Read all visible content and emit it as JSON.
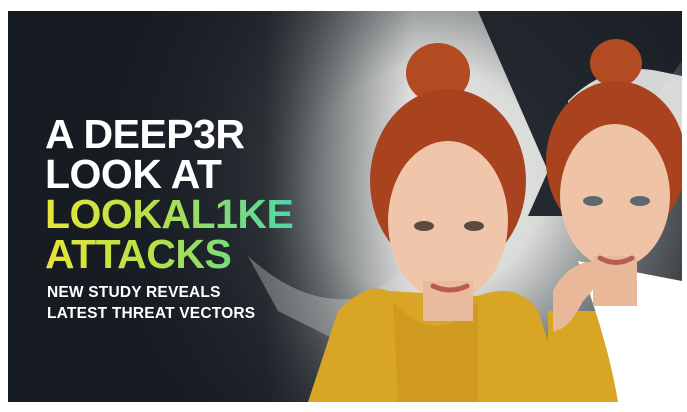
{
  "headline": {
    "line1": "A DEEP3R",
    "line2": "LOOK AT",
    "line3": "LOOKAL1KE",
    "line4": "ATTACKS"
  },
  "subheadline": {
    "line1": "NEW STUDY REVEALS",
    "line2": "LATEST THREAT VECTORS"
  },
  "colors": {
    "background": "#161c22",
    "headline_white": "#ffffff",
    "gradient_start": "#e8e53a",
    "gradient_end": "#4fd6a7",
    "cardigan": "#d8a524",
    "hair": "#b24a22"
  }
}
